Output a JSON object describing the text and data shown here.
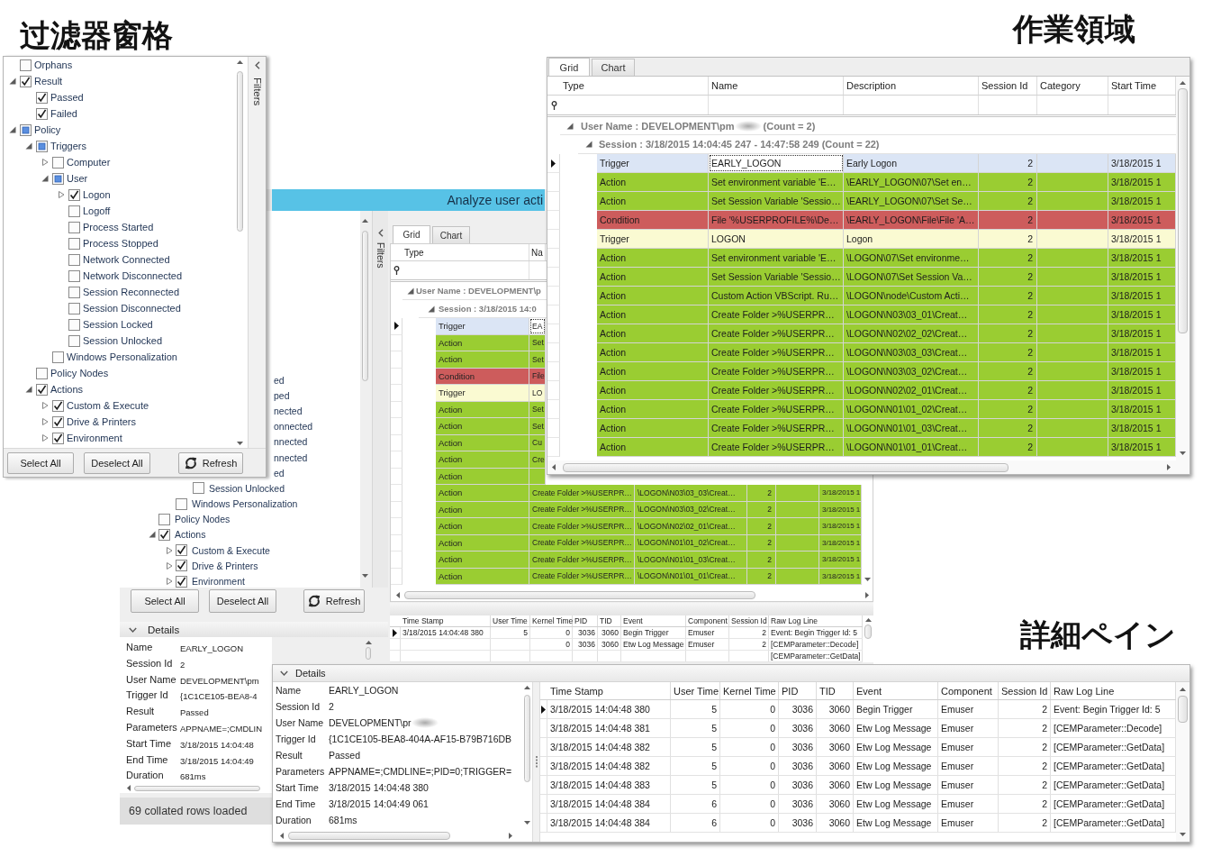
{
  "filter_pane": {
    "caption": "过滤器窗格",
    "side_tab": "Filters",
    "tree": [
      {
        "label": "Orphans",
        "checked": false,
        "partial": false
      },
      {
        "label": "Result",
        "checked": true,
        "partial": false,
        "expanded": true,
        "children": [
          {
            "label": "Passed",
            "checked": true,
            "partial": false
          },
          {
            "label": "Failed",
            "checked": true,
            "partial": false
          }
        ]
      },
      {
        "label": "Policy",
        "checked": false,
        "partial": true,
        "expanded": true,
        "children": [
          {
            "label": "Triggers",
            "checked": false,
            "partial": true,
            "expanded": true,
            "children": [
              {
                "label": "Computer",
                "checked": false,
                "partial": false,
                "expanded": false
              },
              {
                "label": "User",
                "checked": false,
                "partial": true,
                "expanded": true,
                "children": [
                  {
                    "label": "Logon",
                    "checked": true,
                    "partial": false,
                    "expanded": false
                  },
                  {
                    "label": "Logoff",
                    "checked": false,
                    "partial": false
                  },
                  {
                    "label": "Process Started",
                    "checked": false,
                    "partial": false
                  },
                  {
                    "label": "Process Stopped",
                    "checked": false,
                    "partial": false
                  },
                  {
                    "label": "Network Connected",
                    "checked": false,
                    "partial": false
                  },
                  {
                    "label": "Network Disconnected",
                    "checked": false,
                    "partial": false
                  },
                  {
                    "label": "Session Reconnected",
                    "checked": false,
                    "partial": false
                  },
                  {
                    "label": "Session Disconnected",
                    "checked": false,
                    "partial": false
                  },
                  {
                    "label": "Session Locked",
                    "checked": false,
                    "partial": false
                  },
                  {
                    "label": "Session Unlocked",
                    "checked": false,
                    "partial": false
                  }
                ]
              },
              {
                "label": "Windows Personalization",
                "checked": false,
                "partial": false
              }
            ]
          },
          {
            "label": "Policy Nodes",
            "checked": false,
            "partial": false
          },
          {
            "label": "Actions",
            "checked": true,
            "partial": false,
            "expanded": true,
            "children": [
              {
                "label": "Custom & Execute",
                "checked": true,
                "partial": false,
                "expanded": false
              },
              {
                "label": "Drive & Printers",
                "checked": true,
                "partial": false,
                "expanded": false
              },
              {
                "label": "Environment",
                "checked": true,
                "partial": false,
                "expanded": false
              }
            ]
          }
        ]
      }
    ],
    "buttons": [
      {
        "label": "Select All",
        "kind": "text"
      },
      {
        "label": "Deselect All",
        "kind": "text"
      },
      {
        "label": "Refresh",
        "kind": "refresh"
      }
    ]
  },
  "grid_pane": {
    "caption": "作業領域",
    "tabs": [
      {
        "label": "Grid",
        "selected": true
      },
      {
        "label": "Chart",
        "selected": false
      }
    ],
    "columns": [
      "Type",
      "Name",
      "Description",
      "Session Id",
      "Category",
      "Start Time"
    ],
    "groups": [
      {
        "label": "User Name : DEVELOPMENT\\pm",
        "redacted": true,
        "count": "(Count = 2)",
        "expanded": true
      },
      {
        "label": "Session : 3/18/2015 14:04:45 247 - 14:47:58 249 (Count = 22)",
        "redacted": false,
        "expanded": true
      }
    ],
    "rows": [
      {
        "type": "Trigger",
        "name": "EARLY_LOGON",
        "description": "Early Logon",
        "session_id": "2",
        "start_time": "3/18/2015 1",
        "selected": true
      },
      {
        "type": "Action",
        "name": "Set environment variable 'E…",
        "description": "\\EARLY_LOGON\\07\\Set en…",
        "session_id": "2",
        "start_time": "3/18/2015 1",
        "color": "#9acd32",
        "selected": false
      },
      {
        "type": "Action",
        "name": "Set Session Variable 'Sessio…",
        "description": "\\EARLY_LOGON\\07\\Set Se…",
        "session_id": "2",
        "start_time": "3/18/2015 1",
        "color": "#9acd32",
        "selected": false
      },
      {
        "type": "Condition",
        "name": "File '%USERPROFILE%\\De…",
        "description": "\\EARLY_LOGON\\File\\File 'A…",
        "session_id": "2",
        "start_time": "3/18/2015 1",
        "color": "#cd5c5c",
        "selected": false
      },
      {
        "type": "Trigger",
        "name": "LOGON",
        "description": "Logon",
        "session_id": "2",
        "start_time": "3/18/2015 1",
        "color": "#fafad2",
        "selected": false
      },
      {
        "type": "Action",
        "name": "Set environment variable 'E…",
        "description": "\\LOGON\\07\\Set environme…",
        "session_id": "2",
        "start_time": "3/18/2015 1",
        "color": "#9acd32",
        "selected": false
      },
      {
        "type": "Action",
        "name": "Set Session Variable 'Sessio…",
        "description": "\\LOGON\\07\\Set Session Va…",
        "session_id": "2",
        "start_time": "3/18/2015 1",
        "color": "#9acd32",
        "selected": false
      },
      {
        "type": "Action",
        "name": "Custom Action VBScript. Ru…",
        "description": "\\LOGON\\node\\Custom Acti…",
        "session_id": "2",
        "start_time": "3/18/2015 1",
        "color": "#9acd32",
        "selected": false
      },
      {
        "type": "Action",
        "name": "Create Folder >%USERPR…",
        "description": "\\LOGON\\N03\\03_01\\Creat…",
        "session_id": "2",
        "start_time": "3/18/2015 1",
        "color": "#9acd32",
        "selected": false
      },
      {
        "type": "Action",
        "name": "Create Folder >%USERPR…",
        "description": "\\LOGON\\N02\\02_02\\Creat…",
        "session_id": "2",
        "start_time": "3/18/2015 1",
        "color": "#9acd32",
        "selected": false
      },
      {
        "type": "Action",
        "name": "Create Folder >%USERPR…",
        "description": "\\LOGON\\N03\\03_03\\Creat…",
        "session_id": "2",
        "start_time": "3/18/2015 1",
        "color": "#9acd32",
        "selected": false
      },
      {
        "type": "Action",
        "name": "Create Folder >%USERPR…",
        "description": "\\LOGON\\N03\\03_02\\Creat…",
        "session_id": "2",
        "start_time": "3/18/2015 1",
        "color": "#9acd32",
        "selected": false
      },
      {
        "type": "Action",
        "name": "Create Folder >%USERPR…",
        "description": "\\LOGON\\N02\\02_01\\Creat…",
        "session_id": "2",
        "start_time": "3/18/2015 1",
        "color": "#9acd32",
        "selected": false
      },
      {
        "type": "Action",
        "name": "Create Folder >%USERPR…",
        "description": "\\LOGON\\N01\\01_02\\Creat…",
        "session_id": "2",
        "start_time": "3/18/2015 1",
        "color": "#9acd32",
        "selected": false
      },
      {
        "type": "Action",
        "name": "Create Folder >%USERPR…",
        "description": "\\LOGON\\N01\\01_03\\Creat…",
        "session_id": "2",
        "start_time": "3/18/2015 1",
        "color": "#9acd32",
        "selected": false
      },
      {
        "type": "Action",
        "name": "Create Folder >%USERPR…",
        "description": "\\LOGON\\N01\\01_01\\Creat…",
        "session_id": "2",
        "start_time": "3/18/2015 1",
        "color": "#9acd32",
        "selected": false
      }
    ]
  },
  "background_window": {
    "title": "Analyze user acti",
    "side_tab": "Filters",
    "tree": [
      {
        "children": [
          {
            "children": [
              {
                "children": [
                  {
                    "kind": "fragment",
                    "label": "ed"
                  },
                  {
                    "kind": "fragment",
                    "label": "ped"
                  },
                  {
                    "kind": "fragment",
                    "label": "nected"
                  },
                  {
                    "kind": "fragment",
                    "label": "onnected"
                  },
                  {
                    "kind": "fragment",
                    "label": "nnected"
                  },
                  {
                    "kind": "fragment",
                    "label": "nnected"
                  },
                  {
                    "kind": "fragment",
                    "label": "ed"
                  },
                  {
                    "kind": "item",
                    "label": "Session Unlocked",
                    "checked": false
                  }
                ]
              },
              {
                "kind": "item",
                "label": "Windows Personalization",
                "checked": false
              }
            ]
          },
          {
            "kind": "item",
            "label": "Policy Nodes",
            "checked": false
          },
          {
            "kind": "item",
            "label": "Actions",
            "checked": true,
            "expanded": true,
            "children": [
              {
                "kind": "item",
                "label": "Custom & Execute",
                "checked": true,
                "expanded": false
              },
              {
                "kind": "item",
                "label": "Drive & Printers",
                "checked": true,
                "expanded": false
              },
              {
                "kind": "item",
                "label": "Environment",
                "checked": true,
                "expanded": false
              }
            ]
          }
        ]
      }
    ],
    "buttons": [
      {
        "label": "Select All",
        "kind": "text"
      },
      {
        "label": "Deselect All",
        "kind": "text"
      },
      {
        "label": "Refresh",
        "kind": "refresh"
      }
    ],
    "tabs": [
      {
        "label": "Grid",
        "selected": true
      },
      {
        "label": "Chart",
        "selected": false
      }
    ],
    "columns": [
      "Type",
      "Na"
    ],
    "groups": [
      {
        "label": "User Name : DEVELOPMENT\\p",
        "expanded": true
      },
      {
        "label": "Session : 3/18/2015 14:0",
        "expanded": true
      }
    ],
    "rows": [
      {
        "type": "Trigger",
        "name": "EA",
        "selected": true
      },
      {
        "type": "Action",
        "name": "Set",
        "color": "#9acd32",
        "selected": false
      },
      {
        "type": "Action",
        "name": "Set",
        "color": "#9acd32",
        "selected": false
      },
      {
        "type": "Condition",
        "name": "File",
        "color": "#cd5c5c",
        "selected": false
      },
      {
        "type": "Trigger",
        "name": "LO",
        "color": "#fafad2",
        "selected": false
      },
      {
        "type": "Action",
        "name": "Set",
        "color": "#9acd32",
        "selected": false
      },
      {
        "type": "Action",
        "name": "Set",
        "color": "#9acd32",
        "selected": false
      },
      {
        "type": "Action",
        "name": "Cu",
        "color": "#9acd32",
        "selected": false
      },
      {
        "type": "Action",
        "name": "Cre",
        "color": "#9acd32",
        "selected": false
      },
      {
        "type": "Action",
        "color": "#9acd32",
        "selected": false
      },
      {
        "type": "Action",
        "name": "Create Folder >%USERPR…",
        "description": "\\LOGON\\N03\\03_03\\Creat…",
        "session_id": "2",
        "start_time": "3/18/2015 1",
        "color": "#9acd32",
        "selected": false
      },
      {
        "type": "Action",
        "name": "Create Folder >%USERPR…",
        "description": "\\LOGON\\N03\\03_02\\Creat…",
        "session_id": "2",
        "start_time": "3/18/2015 1",
        "color": "#9acd32",
        "selected": false
      },
      {
        "type": "Action",
        "name": "Create Folder >%USERPR…",
        "description": "\\LOGON\\N02\\02_01\\Creat…",
        "session_id": "2",
        "start_time": "3/18/2015 1",
        "color": "#9acd32",
        "selected": false
      },
      {
        "type": "Action",
        "name": "Create Folder >%USERPR…",
        "description": "\\LOGON\\N01\\01_02\\Creat…",
        "session_id": "2",
        "start_time": "3/18/2015 1",
        "color": "#9acd32",
        "selected": false
      },
      {
        "type": "Action",
        "name": "Create Folder >%USERPR…",
        "description": "\\LOGON\\N01\\01_03\\Creat…",
        "session_id": "2",
        "start_time": "3/18/2015 1",
        "color": "#9acd32",
        "selected": false
      },
      {
        "type": "Action",
        "name": "Create Folder >%USERPR…",
        "description": "\\LOGON\\N01\\01_01\\Creat…",
        "session_id": "2",
        "start_time": "3/18/2015 1",
        "color": "#9acd32",
        "selected": false
      }
    ],
    "details_title": "Details",
    "properties": [
      {
        "label": "Name",
        "value": "EARLY_LOGON"
      },
      {
        "label": "Session Id",
        "value": "2"
      },
      {
        "label": "User Name",
        "value": "DEVELOPMENT\\pm"
      },
      {
        "label": "Trigger Id",
        "value": "{1C1CE105-BEA8-4"
      },
      {
        "label": "Result",
        "value": "Passed"
      },
      {
        "label": "Parameters",
        "value": "APPNAME=;CMDLIN"
      },
      {
        "label": "Start Time",
        "value": "3/18/2015 14:04:48"
      },
      {
        "label": "End Time",
        "value": "3/18/2015 14:04:49"
      },
      {
        "label": "Duration",
        "value": "681ms"
      }
    ],
    "event_columns": [
      "Time Stamp",
      "User Time",
      "Kernel Time",
      "PID",
      "TID",
      "Event",
      "Component",
      "Session Id",
      "Raw Log Line"
    ],
    "events": [
      {
        "selected": true,
        "time_stamp": "3/18/2015 14:04:48 380",
        "user_time": "5",
        "kernel_time": "0",
        "pid": "3036",
        "tid": "3060",
        "event": "Begin Trigger",
        "component": "Emuser",
        "session_id": "2",
        "raw_log_line": "Event: Begin Trigger Id: 5"
      },
      {
        "selected": false,
        "kernel_time": "0",
        "pid": "3036",
        "tid": "3060",
        "event": "Etw Log Message",
        "component": "Emuser",
        "session_id": "2",
        "raw_log_line": "[CEMParameter::Decode]"
      },
      {
        "selected": false,
        "raw_log_line": "[CEMParameter::GetData]"
      }
    ],
    "status": "69 collated rows loaded"
  },
  "details_pane": {
    "caption": "詳細ペイン",
    "title": "Details",
    "properties": [
      {
        "label": "Name",
        "value": "EARLY_LOGON",
        "redacted": false
      },
      {
        "label": "Session Id",
        "value": "2",
        "redacted": false
      },
      {
        "label": "User Name",
        "value": "DEVELOPMENT\\pr",
        "redacted": true
      },
      {
        "label": "Trigger Id",
        "value": "{1C1CE105-BEA8-404A-AF15-B79B716DB",
        "redacted": false
      },
      {
        "label": "Result",
        "value": "Passed",
        "redacted": false
      },
      {
        "label": "Parameters",
        "value": "APPNAME=;CMDLINE=;PID=0;TRIGGER=",
        "redacted": false
      },
      {
        "label": "Start Time",
        "value": "3/18/2015 14:04:48 380",
        "redacted": false
      },
      {
        "label": "End Time",
        "value": "3/18/2015 14:04:49 061",
        "redacted": false
      },
      {
        "label": "Duration",
        "value": "681ms",
        "redacted": false
      }
    ],
    "event_columns": [
      "Time Stamp",
      "User Time",
      "Kernel Time",
      "PID",
      "TID",
      "Event",
      "Component",
      "Session Id",
      "Raw Log Line"
    ],
    "events": [
      {
        "selected": true,
        "time_stamp": "3/18/2015 14:04:48 380",
        "user_time": "5",
        "kernel_time": "0",
        "pid": "3036",
        "tid": "3060",
        "event": "Begin Trigger",
        "component": "Emuser",
        "session_id": "2",
        "raw_log_line": "Event: Begin Trigger Id: 5"
      },
      {
        "selected": false,
        "time_stamp": "3/18/2015 14:04:48 381",
        "user_time": "5",
        "kernel_time": "0",
        "pid": "3036",
        "tid": "3060",
        "event": "Etw Log Message",
        "component": "Emuser",
        "session_id": "2",
        "raw_log_line": "[CEMParameter::Decode]"
      },
      {
        "selected": false,
        "time_stamp": "3/18/2015 14:04:48 382",
        "user_time": "5",
        "kernel_time": "0",
        "pid": "3036",
        "tid": "3060",
        "event": "Etw Log Message",
        "component": "Emuser",
        "session_id": "2",
        "raw_log_line": "[CEMParameter::GetData]"
      },
      {
        "selected": false,
        "time_stamp": "3/18/2015 14:04:48 382",
        "user_time": "5",
        "kernel_time": "0",
        "pid": "3036",
        "tid": "3060",
        "event": "Etw Log Message",
        "component": "Emuser",
        "session_id": "2",
        "raw_log_line": "[CEMParameter::GetData]"
      },
      {
        "selected": false,
        "time_stamp": "3/18/2015 14:04:48 383",
        "user_time": "5",
        "kernel_time": "0",
        "pid": "3036",
        "tid": "3060",
        "event": "Etw Log Message",
        "component": "Emuser",
        "session_id": "2",
        "raw_log_line": "[CEMParameter::GetData]"
      },
      {
        "selected": false,
        "time_stamp": "3/18/2015 14:04:48 384",
        "user_time": "6",
        "kernel_time": "0",
        "pid": "3036",
        "tid": "3060",
        "event": "Etw Log Message",
        "component": "Emuser",
        "session_id": "2",
        "raw_log_line": "[CEMParameter::GetData]"
      },
      {
        "selected": false,
        "time_stamp": "3/18/2015 14:04:48 384",
        "user_time": "6",
        "kernel_time": "0",
        "pid": "3036",
        "tid": "3060",
        "event": "Etw Log Message",
        "component": "Emuser",
        "session_id": "2",
        "raw_log_line": "[CEMParameter::GetData]"
      }
    ]
  }
}
